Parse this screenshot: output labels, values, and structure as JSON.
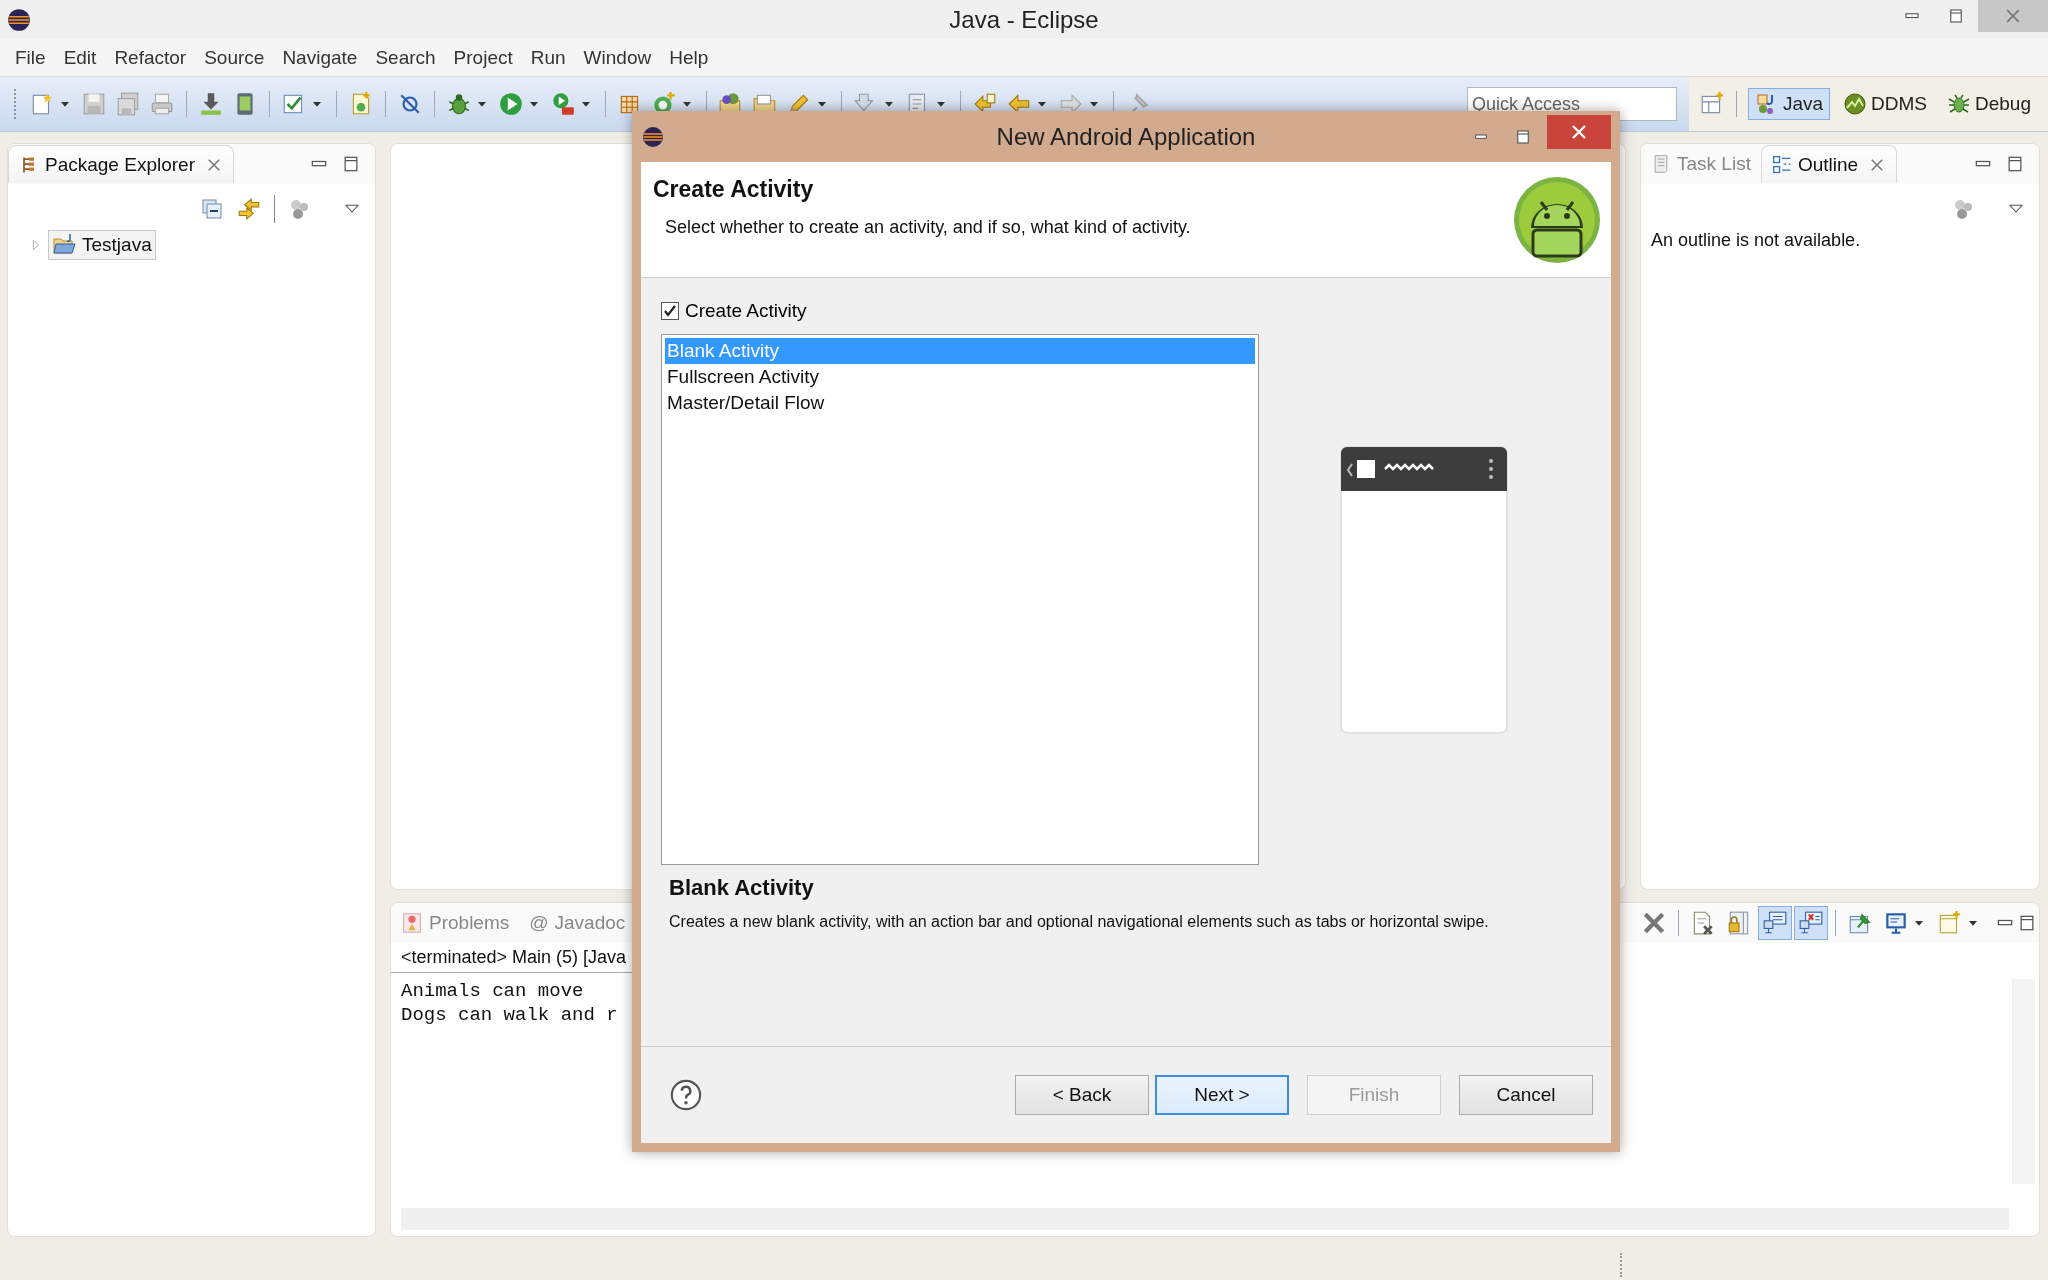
{
  "window": {
    "title": "Java - Eclipse"
  },
  "menu": [
    "File",
    "Edit",
    "Refactor",
    "Source",
    "Navigate",
    "Search",
    "Project",
    "Run",
    "Window",
    "Help"
  ],
  "quick_access": {
    "placeholder": "Quick Access"
  },
  "perspectives": [
    {
      "label": "Java",
      "selected": true
    },
    {
      "label": "DDMS",
      "selected": false
    },
    {
      "label": "Debug",
      "selected": false
    }
  ],
  "package_explorer": {
    "tab": "Package Explorer",
    "tree": [
      {
        "label": "Testjava",
        "expanded": false,
        "selected": true
      }
    ]
  },
  "outline_panel": {
    "tabs": [
      {
        "label": "Task List",
        "selected": false
      },
      {
        "label": "Outline",
        "selected": true
      }
    ],
    "message": "An outline is not available."
  },
  "console_panel": {
    "tabs": [
      {
        "label": "Problems",
        "selected": false
      },
      {
        "label": "Javadoc",
        "icon": "@",
        "selected": false
      }
    ],
    "status": "<terminated> Main (5) [Java",
    "lines": [
      "Animals can move",
      "Dogs can walk and r"
    ],
    "toolbar": [
      {
        "kind": "remove-all",
        "pressed": false
      },
      {
        "kind": "clear",
        "pressed": false
      },
      {
        "kind": "scroll-lock",
        "pressed": false
      },
      {
        "kind": "show-out",
        "pressed": true
      },
      {
        "kind": "show-err",
        "pressed": true
      },
      {
        "kind": "pin",
        "pressed": false
      },
      {
        "kind": "display",
        "pressed": false
      },
      {
        "kind": "new-console",
        "pressed": false
      }
    ]
  },
  "dialog": {
    "title": "New Android Application",
    "heading": "Create Activity",
    "subtitle": "Select whether to create an activity, and if so, what kind of activity.",
    "create_activity": {
      "label": "Create Activity",
      "checked": true
    },
    "activities": [
      {
        "label": "Blank Activity",
        "selected": true
      },
      {
        "label": "Fullscreen Activity",
        "selected": false
      },
      {
        "label": "Master/Detail Flow",
        "selected": false
      }
    ],
    "description_title": "Blank Activity",
    "description": "Creates a new blank activity, with an action bar and optional navigational elements such as tabs or horizontal swipe.",
    "buttons": [
      {
        "label": "< Back",
        "disabled": false,
        "default": false
      },
      {
        "label": "Next >",
        "disabled": false,
        "default": true
      },
      {
        "label": "Finish",
        "disabled": true,
        "default": false
      },
      {
        "label": "Cancel",
        "disabled": false,
        "default": false
      }
    ]
  }
}
